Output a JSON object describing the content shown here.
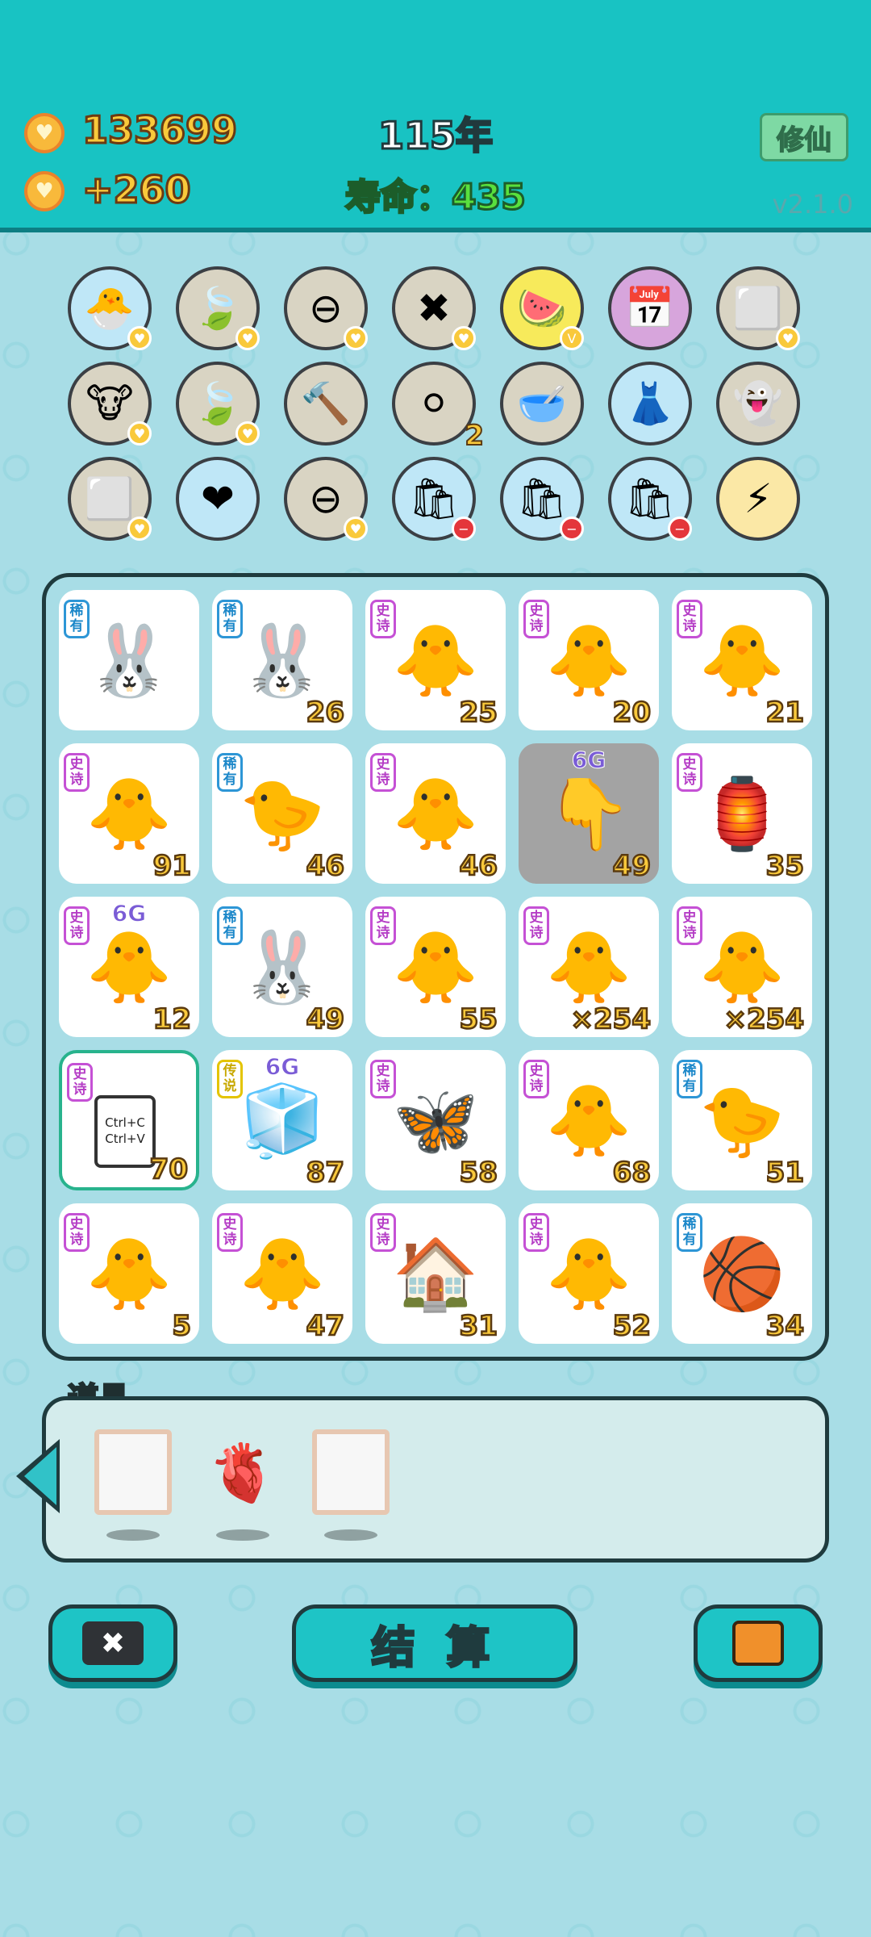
{
  "hud": {
    "coins": "133699",
    "income": "+260",
    "year": "115年",
    "lifespan": "寿命：435",
    "cultivate_label": "修仙",
    "version": "v2.1.0"
  },
  "skills_row1": [
    {
      "icon": "chicken-egg-icon",
      "glyph": "🐣",
      "bg": "#bfe7f7",
      "mini": "coin"
    },
    {
      "icon": "leaf-icon",
      "glyph": "🍃",
      "bg": "#d9d4c3",
      "mini": "coin"
    },
    {
      "icon": "minus-icon",
      "glyph": "⊖",
      "bg": "#d9d4c3",
      "mini": "coin"
    },
    {
      "icon": "delete-tag-icon",
      "glyph": "✖",
      "bg": "#d9d4c3",
      "mini": "coin"
    },
    {
      "icon": "fruit-basket-icon",
      "glyph": "🍉",
      "bg": "#f7ea5b",
      "mini": "v"
    },
    {
      "icon": "calendar-icon",
      "glyph": "📅",
      "bg": "#d7a5dc",
      "mini": ""
    },
    {
      "icon": "cubes-icon",
      "glyph": "⬜",
      "bg": "#d9d4c3",
      "mini": "coin"
    }
  ],
  "skills_row2": [
    {
      "icon": "cows-icon",
      "glyph": "🐮",
      "bg": "#d9d4c3",
      "mini": "coin"
    },
    {
      "icon": "leaf-icon",
      "glyph": "🍃",
      "bg": "#d9d4c3",
      "mini": "coin"
    },
    {
      "icon": "hammer-icon",
      "glyph": "🔨",
      "bg": "#d9d4c3",
      "mini": ""
    },
    {
      "icon": "egg-tray-icon",
      "glyph": "⚪",
      "bg": "#d9d4c3",
      "mini": "",
      "count": "2"
    },
    {
      "icon": "dog-bowl-icon",
      "glyph": "🥣",
      "bg": "#d9d4c3",
      "mini": ""
    },
    {
      "icon": "skirt-icon",
      "glyph": "👗",
      "bg": "#bfe7f7",
      "mini": ""
    },
    {
      "icon": "ghost-icon",
      "glyph": "👻",
      "bg": "#d9d4c3",
      "mini": ""
    }
  ],
  "skills_row3": [
    {
      "icon": "cubes-icon",
      "glyph": "⬜",
      "bg": "#d9d4c3",
      "mini": "coin"
    },
    {
      "icon": "heart-drip-icon",
      "glyph": "❤",
      "bg": "#bfe7f7",
      "mini": ""
    },
    {
      "icon": "minus-icon",
      "glyph": "⊖",
      "bg": "#d9d4c3",
      "mini": "coin"
    },
    {
      "icon": "trash-bag-icon",
      "glyph": "🛍",
      "bg": "#bfe7f7",
      "mini": "red"
    },
    {
      "icon": "trash-bag-icon",
      "glyph": "🛍",
      "bg": "#bfe7f7",
      "mini": "red"
    },
    {
      "icon": "trash-bag-icon",
      "glyph": "🛍",
      "bg": "#bfe7f7",
      "mini": "red"
    },
    {
      "icon": "lightning-icon",
      "glyph": "⚡",
      "bg": "#fbe8a6",
      "mini": ""
    }
  ],
  "board": [
    [
      {
        "tag": "稀有",
        "rarity": "rare",
        "icon": "rabbit-icon",
        "glyph": "🐰",
        "num": ""
      },
      {
        "tag": "稀有",
        "rarity": "rare",
        "icon": "rabbit-icon",
        "glyph": "🐰",
        "num": "26"
      },
      {
        "tag": "史诗",
        "rarity": "epic",
        "icon": "gray-hair-chick-icon",
        "glyph": "🐥",
        "num": "25"
      },
      {
        "tag": "史诗",
        "rarity": "epic",
        "icon": "gray-hair-chick-icon",
        "glyph": "🐥",
        "num": "20"
      },
      {
        "tag": "史诗",
        "rarity": "epic",
        "icon": "gray-hair-chick-icon",
        "glyph": "🐥",
        "num": "21"
      }
    ],
    [
      {
        "tag": "史诗",
        "rarity": "epic",
        "icon": "gray-hair-chick-icon",
        "glyph": "🐥",
        "num": "91"
      },
      {
        "tag": "稀有",
        "rarity": "rare",
        "icon": "chick-icon",
        "glyph": "🐤",
        "num": "46"
      },
      {
        "tag": "史诗",
        "rarity": "epic",
        "icon": "gray-hair-chick-icon",
        "glyph": "🐥",
        "num": "46"
      },
      {
        "tag": "",
        "rarity": "",
        "icon": "pointing-hand-icon",
        "glyph": "👇",
        "num": "49",
        "top": "6G",
        "gray": true
      },
      {
        "tag": "史诗",
        "rarity": "epic",
        "icon": "lantern-house-icon",
        "glyph": "🏮",
        "num": "35"
      }
    ],
    [
      {
        "tag": "史诗",
        "rarity": "epic",
        "icon": "crowned-chick-icon",
        "glyph": "🐥",
        "num": "12",
        "top": "6G"
      },
      {
        "tag": "稀有",
        "rarity": "rare",
        "icon": "rabbit-icon",
        "glyph": "🐰",
        "num": "49"
      },
      {
        "tag": "史诗",
        "rarity": "epic",
        "icon": "gray-hair-chick-icon",
        "glyph": "🐥",
        "num": "55"
      },
      {
        "tag": "史诗",
        "rarity": "epic",
        "icon": "gray-hair-chick-icon",
        "glyph": "🐥",
        "num": "×254"
      },
      {
        "tag": "史诗",
        "rarity": "epic",
        "icon": "gray-hair-chick-icon",
        "glyph": "🐥",
        "num": "×254"
      }
    ],
    [
      {
        "tag": "史诗",
        "rarity": "epic",
        "icon": "copy-paste-icon",
        "glyph": "",
        "num": "70",
        "copy": "Ctrl+C Ctrl+V",
        "selected": true
      },
      {
        "tag": "传说",
        "rarity": "legend",
        "icon": "fridge-icon",
        "glyph": "🧊",
        "num": "87",
        "top": "6G"
      },
      {
        "tag": "史诗",
        "rarity": "epic",
        "icon": "butterfly-frame-icon",
        "glyph": "🦋",
        "num": "58"
      },
      {
        "tag": "史诗",
        "rarity": "epic",
        "icon": "gray-hair-chick-icon",
        "glyph": "🐥",
        "num": "68"
      },
      {
        "tag": "稀有",
        "rarity": "rare",
        "icon": "chick-icon",
        "glyph": "🐤",
        "num": "51"
      }
    ],
    [
      {
        "tag": "史诗",
        "rarity": "epic",
        "icon": "gray-hair-chick-icon",
        "glyph": "🐥",
        "num": "5"
      },
      {
        "tag": "史诗",
        "rarity": "epic",
        "icon": "gray-hair-chick-icon",
        "glyph": "🐥",
        "num": "47"
      },
      {
        "tag": "史诗",
        "rarity": "epic",
        "icon": "rabbit-house-icon",
        "glyph": "🏠",
        "num": "31"
      },
      {
        "tag": "史诗",
        "rarity": "epic",
        "icon": "gray-hair-chick-icon",
        "glyph": "🐥",
        "num": "52"
      },
      {
        "tag": "稀有",
        "rarity": "rare",
        "icon": "basketball-chick-icon",
        "glyph": "🏀",
        "num": "34"
      }
    ]
  ],
  "inventory": {
    "title": "道具",
    "items": [
      {
        "icon": "empty-frame-icon",
        "glyph": ""
      },
      {
        "icon": "liver-icon",
        "glyph": "🫀"
      },
      {
        "icon": "empty-frame-icon",
        "glyph": ""
      }
    ]
  },
  "buttons": {
    "settle_label": "结 算"
  }
}
